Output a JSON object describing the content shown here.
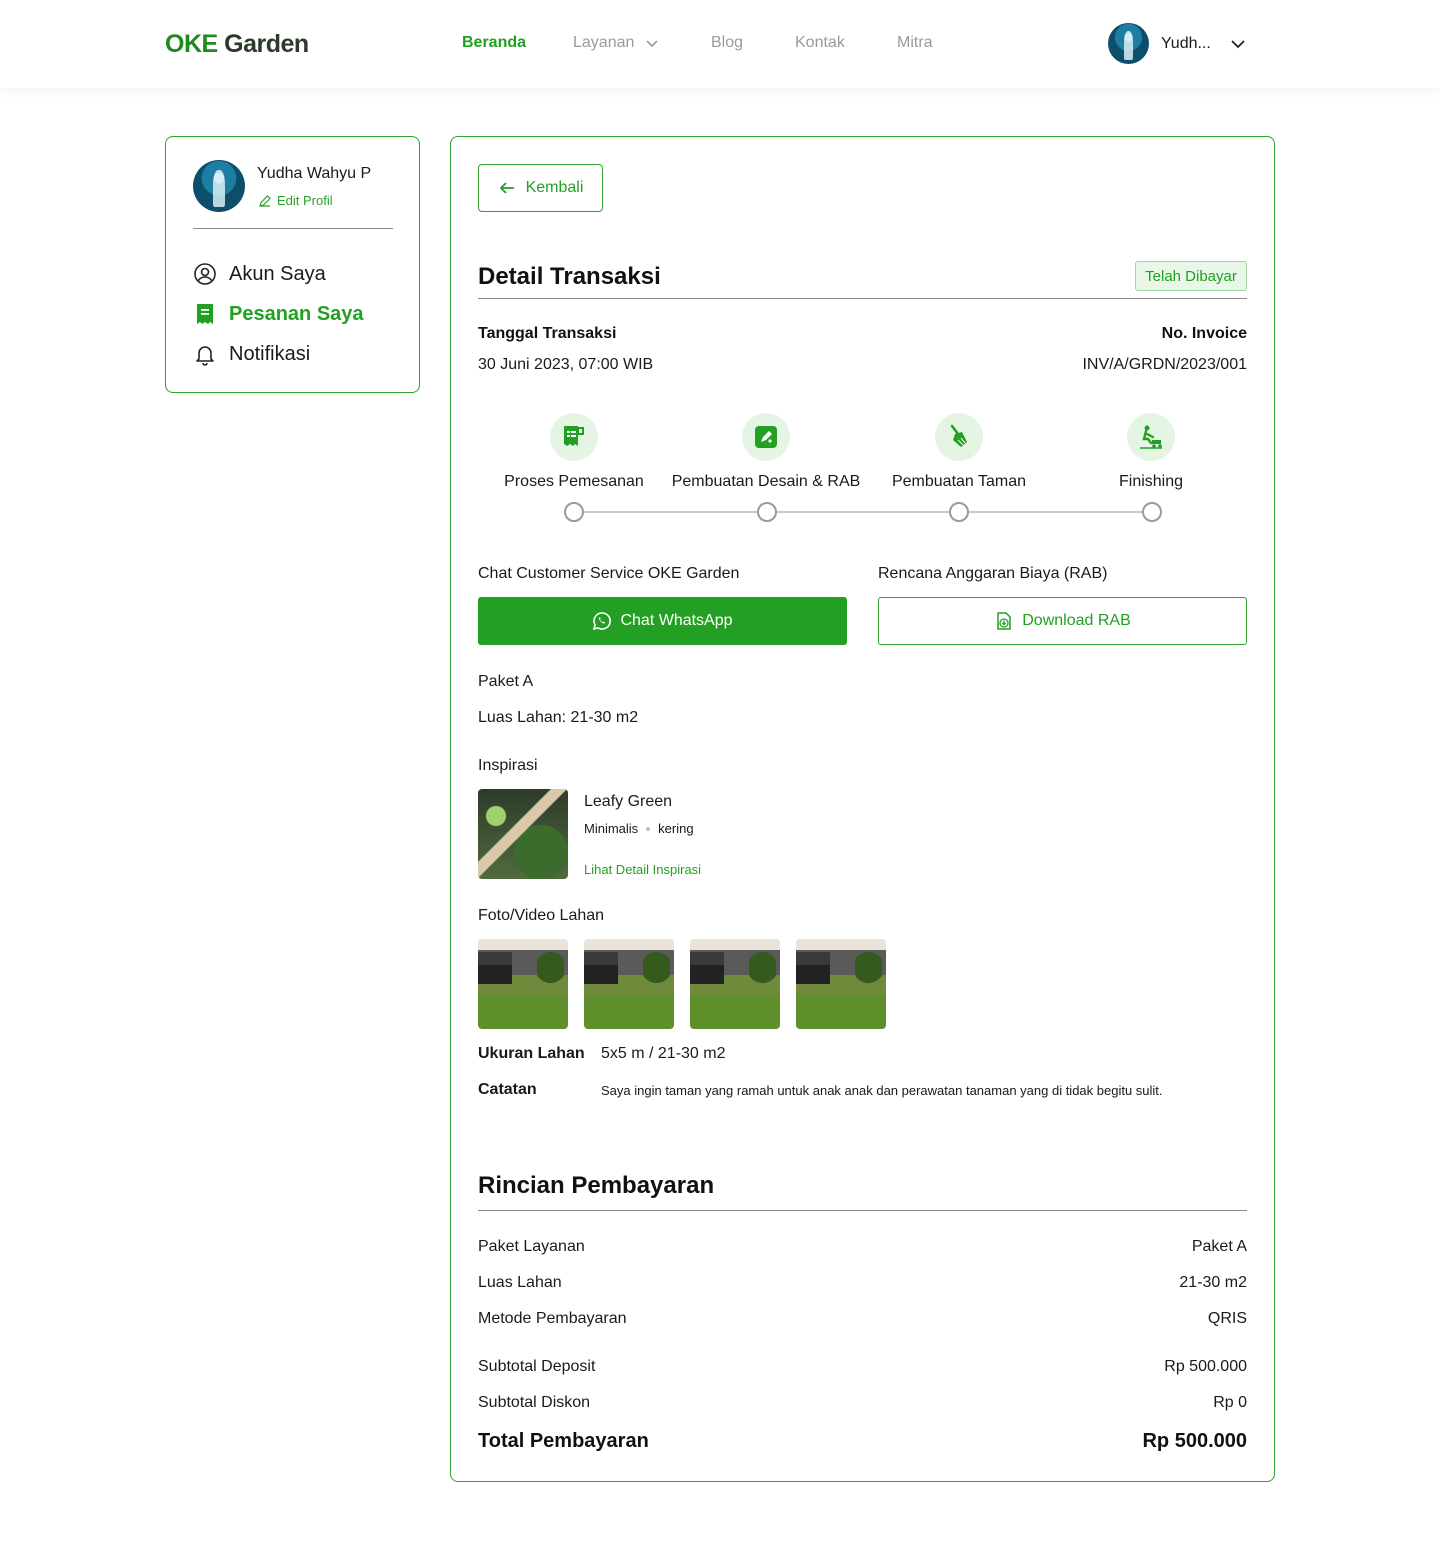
{
  "header": {
    "logo_oke": "OKE",
    "logo_garden": "Garden",
    "nav": [
      {
        "label": "Beranda",
        "active": true
      },
      {
        "label": "Layanan",
        "dropdown": true
      },
      {
        "label": "Blog"
      },
      {
        "label": "Kontak"
      },
      {
        "label": "Mitra"
      }
    ],
    "user_name": "Yudh..."
  },
  "sidebar": {
    "name": "Yudha Wahyu P",
    "edit_label": "Edit Profil",
    "items": [
      {
        "label": "Akun Saya",
        "icon": "user-circle-icon"
      },
      {
        "label": "Pesanan Saya",
        "icon": "receipt-icon",
        "active": true
      },
      {
        "label": "Notifikasi",
        "icon": "bell-icon"
      }
    ]
  },
  "detail": {
    "back_label": "Kembali",
    "title": "Detail Transaksi",
    "status": "Telah Dibayar",
    "date_label": "Tanggal Transaksi",
    "date_value": "30 Juni 2023, 07:00 WIB",
    "invoice_label": "No. Invoice",
    "invoice_value": "INV/A/GRDN/2023/001",
    "steps": [
      {
        "label": "Proses Pemesanan",
        "icon": "order-icon"
      },
      {
        "label": "Pembuatan Desain & RAB",
        "icon": "design-icon"
      },
      {
        "label": "Pembuatan Taman",
        "icon": "broom-icon"
      },
      {
        "label": "Finishing",
        "icon": "mower-icon"
      }
    ],
    "chat_label": "Chat Customer Service OKE Garden",
    "chat_button": "Chat WhatsApp",
    "rab_label": "Rencana Anggaran Biaya (RAB)",
    "rab_button": "Download RAB",
    "package": "Paket A",
    "land_area": "Luas Lahan: 21-30 m2",
    "inspiration_label": "Inspirasi",
    "inspiration": {
      "name": "Leafy Green",
      "tag1": "Minimalis",
      "tag2": "kering",
      "link": "Lihat Detail Inspirasi"
    },
    "photos_label": "Foto/Video Lahan",
    "size_label": "Ukuran Lahan",
    "size_value": "5x5 m / 21-30 m2",
    "notes_label": "Catatan",
    "notes_value": "Saya ingin taman yang ramah untuk anak anak dan perawatan tanaman yang di tidak begitu sulit."
  },
  "payment": {
    "title": "Rincian Pembayaran",
    "rows": [
      {
        "label": "Paket Layanan",
        "value": "Paket A"
      },
      {
        "label": "Luas Lahan",
        "value": "21-30 m2"
      },
      {
        "label": "Metode Pembayaran",
        "value": "QRIS"
      },
      {
        "label": "Subtotal Deposit",
        "value": "Rp 500.000"
      },
      {
        "label": "Subtotal Diskon",
        "value": "Rp 0"
      }
    ],
    "total_label": "Total Pembayaran",
    "total_value": "Rp 500.000"
  },
  "colors": {
    "accent": "#23a023",
    "border": "#2fa02f",
    "badge_bg": "#e8f7e8"
  }
}
